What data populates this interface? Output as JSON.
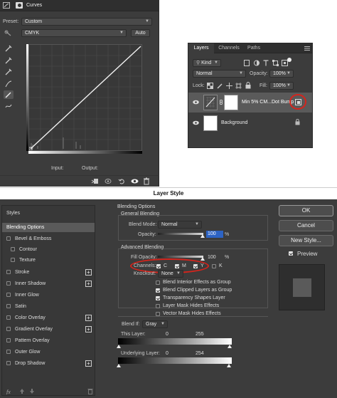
{
  "curves": {
    "title": "Curves",
    "preset_label": "Preset:",
    "preset_value": "Custom",
    "channel_value": "CMYK",
    "auto_label": "Auto",
    "input_label": "Input:",
    "output_label": "Output:"
  },
  "layers_panel": {
    "tabs": [
      "Layers",
      "Channels",
      "Paths"
    ],
    "filter_kind": "Kind",
    "blend_mode": "Normal",
    "opacity_label": "Opacity:",
    "opacity_value": "100%",
    "lock_label": "Lock:",
    "fill_label": "Fill:",
    "fill_value": "100%",
    "layers": [
      {
        "name": "Min 5% CM...Dot Bump"
      },
      {
        "name": "Background"
      }
    ]
  },
  "layer_style": {
    "dialog_title": "Layer Style",
    "styles_header": "Styles",
    "style_items": [
      {
        "label": "Blending Options",
        "checkbox": false,
        "plus": false
      },
      {
        "label": "Bevel & Emboss",
        "checkbox": true,
        "plus": false
      },
      {
        "label": "Contour",
        "checkbox": true,
        "plus": false
      },
      {
        "label": "Texture",
        "checkbox": true,
        "plus": false
      },
      {
        "label": "Stroke",
        "checkbox": true,
        "plus": true
      },
      {
        "label": "Inner Shadow",
        "checkbox": true,
        "plus": true
      },
      {
        "label": "Inner Glow",
        "checkbox": true,
        "plus": false
      },
      {
        "label": "Satin",
        "checkbox": true,
        "plus": false
      },
      {
        "label": "Color Overlay",
        "checkbox": true,
        "plus": true
      },
      {
        "label": "Gradient Overlay",
        "checkbox": true,
        "plus": true
      },
      {
        "label": "Pattern Overlay",
        "checkbox": true,
        "plus": false
      },
      {
        "label": "Outer Glow",
        "checkbox": true,
        "plus": false
      },
      {
        "label": "Drop Shadow",
        "checkbox": true,
        "plus": true
      }
    ],
    "blending_options_title": "Blending Options",
    "general_blending": "General Blending",
    "blend_mode_label": "Blend Mode:",
    "blend_mode_value": "Normal",
    "opacity_label": "Opacity:",
    "opacity_value": "100",
    "opacity_unit": "%",
    "advanced_blending": "Advanced Blending",
    "fill_opacity_label": "Fill Opacity:",
    "fill_opacity_value": "100",
    "fill_opacity_unit": "%",
    "channels_label": "Channels:",
    "channels": [
      {
        "label": "C",
        "checked": true
      },
      {
        "label": "M",
        "checked": true
      },
      {
        "label": "Y",
        "checked": true
      },
      {
        "label": "K",
        "checked": false
      }
    ],
    "knockout_label": "Knockout:",
    "knockout_value": "None",
    "options": [
      {
        "label": "Blend Interior Effects as Group",
        "checked": false
      },
      {
        "label": "Blend Clipped Layers as Group",
        "checked": true
      },
      {
        "label": "Transparency Shapes Layer",
        "checked": true
      },
      {
        "label": "Layer Mask Hides Effects",
        "checked": false
      },
      {
        "label": "Vector Mask Hides Effects",
        "checked": false
      }
    ],
    "blend_if_label": "Blend If:",
    "blend_if_value": "Gray",
    "this_layer_label": "This Layer:",
    "this_layer_min": "0",
    "this_layer_max": "255",
    "underlying_label": "Underlying Layer:",
    "underlying_min": "0",
    "underlying_max": "254",
    "ok_label": "OK",
    "cancel_label": "Cancel",
    "new_style_label": "New Style...",
    "preview_label": "Preview"
  },
  "colors": {
    "annotation_red": "#d6241c",
    "selection_blue": "#2d63c4"
  }
}
